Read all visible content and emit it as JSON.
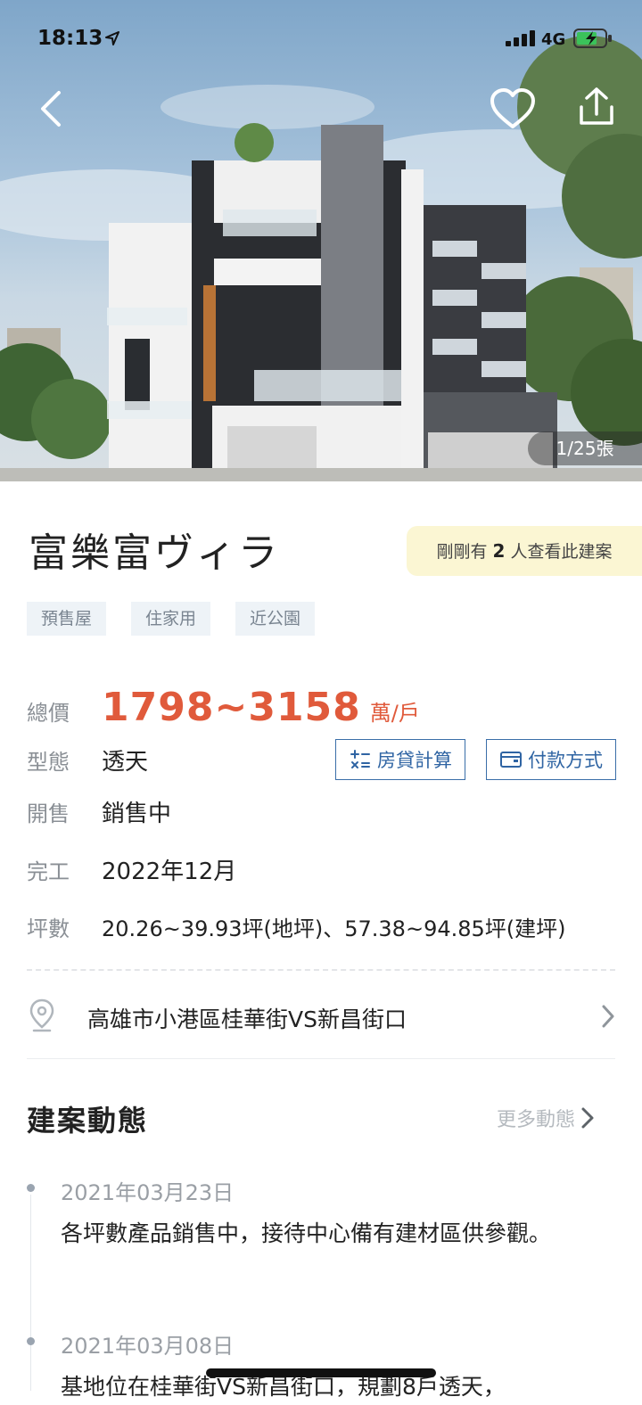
{
  "status_bar": {
    "time": "18:13",
    "network": "4G"
  },
  "hero": {
    "photo_counter": "1/25張"
  },
  "listing": {
    "title": "富樂富ヴィラ",
    "viewers_prefix": "剛剛有",
    "viewers_count": "2",
    "viewers_suffix": "人查看此建案",
    "tags": [
      "預售屋",
      "住家用",
      "近公園"
    ]
  },
  "info": {
    "price_label": "總價",
    "price_value": "1798~3158",
    "price_unit": "萬/戶",
    "type_label": "型態",
    "type_value": "透天",
    "sale_label": "開售",
    "sale_value": "銷售中",
    "complete_label": "完工",
    "complete_value": "2022年12月",
    "area_label": "坪數",
    "area_value": "20.26~39.93坪(地坪)、57.38~94.85坪(建坪)",
    "mortgage_btn": "房貸計算",
    "payment_btn": "付款方式"
  },
  "address": {
    "text": "高雄市小港區桂華街VS新昌街口"
  },
  "news": {
    "title": "建案動態",
    "more_label": "更多動態",
    "items": [
      {
        "date": "2021年03月23日",
        "text": "各坪數產品銷售中，接待中心備有建材區供參觀。"
      },
      {
        "date": "2021年03月08日",
        "text": "基地位在桂華街VS新昌街口，規劃8戶透天，"
      }
    ]
  },
  "colors": {
    "price": "#e05a3b",
    "button_border": "#3a6ea8",
    "viewer_badge": "#fbf6d3"
  }
}
